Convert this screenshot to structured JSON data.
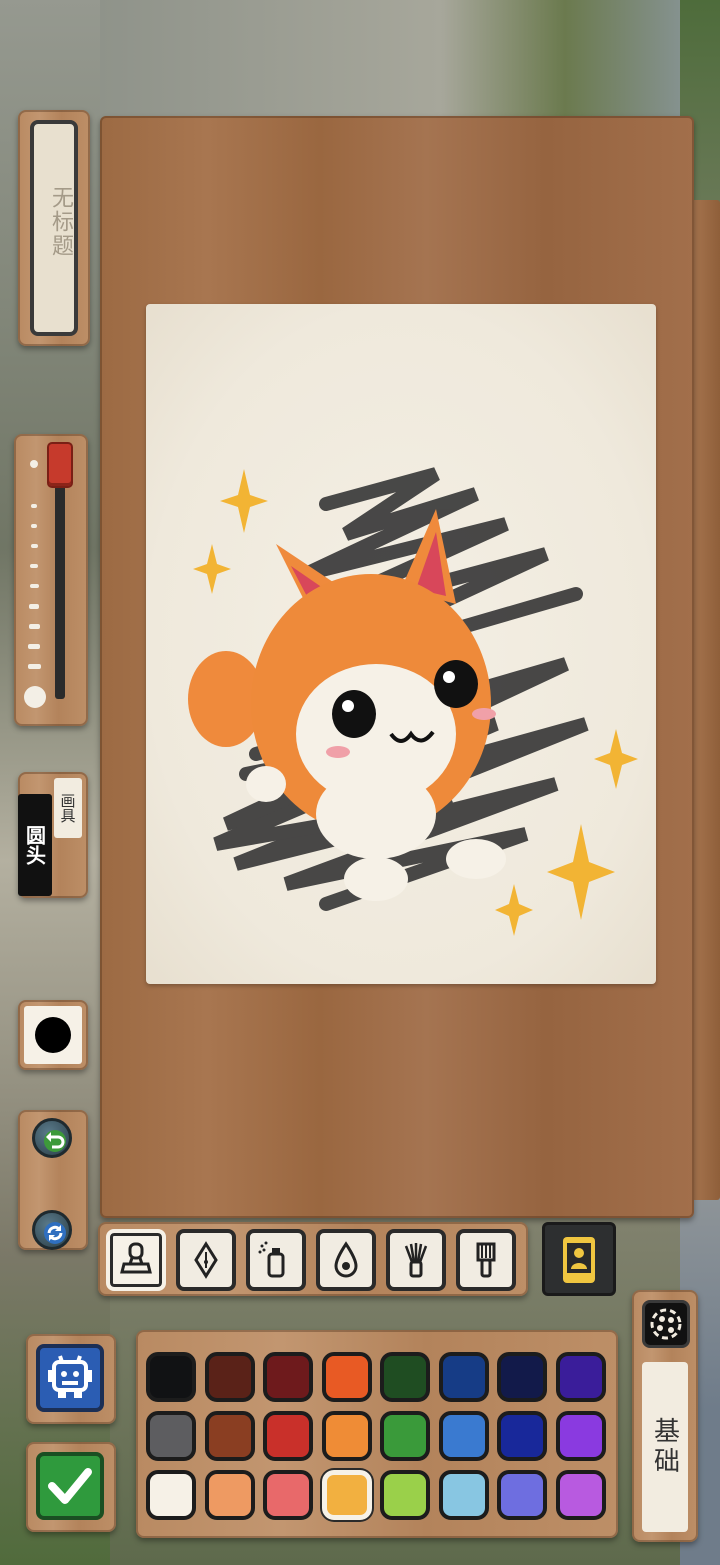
{
  "canvas_title": "无标题",
  "brush": {
    "tag": "画具",
    "name": "圆头"
  },
  "current_color": "#000000",
  "brush_size_level": 0.1,
  "tools": [
    {
      "name": "stamp-tool",
      "icon": "stamp-icon",
      "active": true
    },
    {
      "name": "pen-tool",
      "icon": "fountain-pen-icon",
      "active": false
    },
    {
      "name": "spray-tool",
      "icon": "spray-can-icon",
      "active": false
    },
    {
      "name": "fill-tool",
      "icon": "paint-drop-icon",
      "active": false
    },
    {
      "name": "fan-brush-tool",
      "icon": "fan-brush-icon",
      "active": false
    },
    {
      "name": "flat-brush-tool",
      "icon": "flat-brush-icon",
      "active": false
    }
  ],
  "palette": {
    "rows": [
      [
        "#111214",
        "#5a2218",
        "#6e1a1c",
        "#e85a24",
        "#1f4d22",
        "#163c86",
        "#121a4a",
        "#3a1d9a"
      ],
      [
        "#5d5d60",
        "#8a3e22",
        "#c9302a",
        "#ef8c36",
        "#3a9a3a",
        "#3a7ad0",
        "#18289a",
        "#8a3ae0"
      ],
      [
        "#f6f1e7",
        "#ee9a62",
        "#e8696a",
        "#f2b040",
        "#9ad04a",
        "#88c6e2",
        "#6e6ee0",
        "#b85ae0"
      ]
    ],
    "selected": "#f2b040"
  },
  "mode_label": "基础"
}
